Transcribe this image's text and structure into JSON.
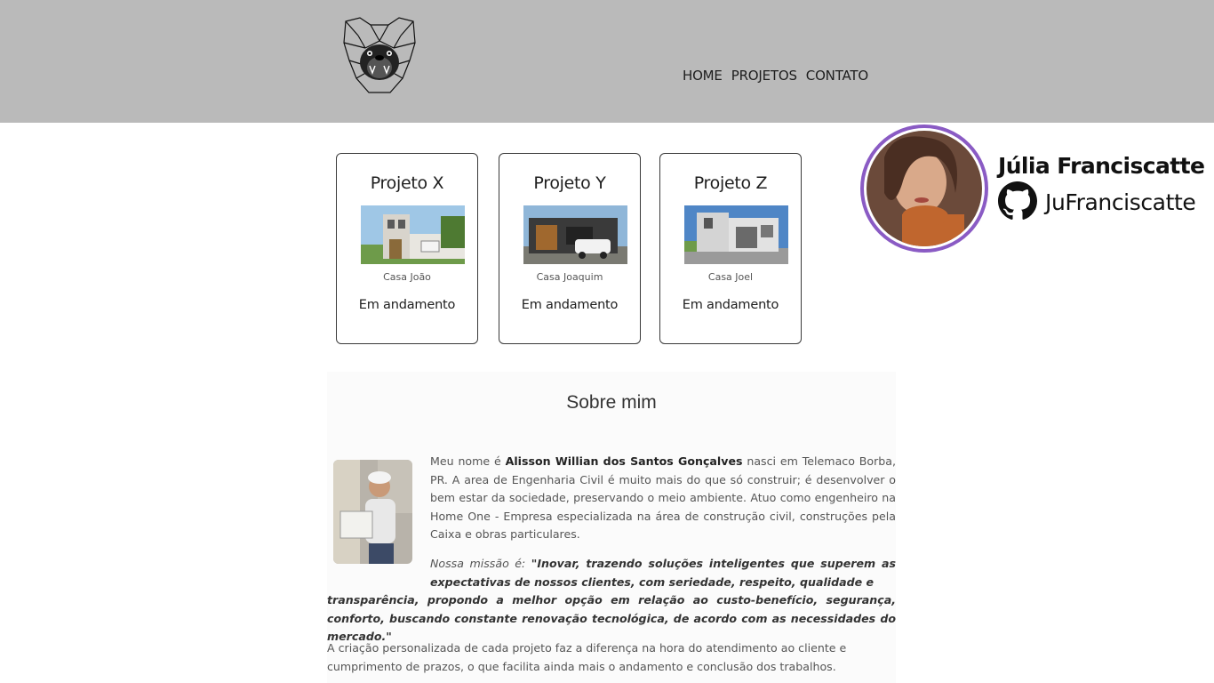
{
  "nav": {
    "items": [
      "HOME",
      "PROJETOS",
      "CONTATO"
    ]
  },
  "projects": [
    {
      "title": "Projeto X",
      "caption": "Casa João",
      "status": "Em andamento"
    },
    {
      "title": "Projeto Y",
      "caption": "Casa Joaquim",
      "status": "Em andamento"
    },
    {
      "title": "Projeto Z",
      "caption": "Casa Joel",
      "status": "Em andamento"
    }
  ],
  "profile": {
    "name": "Júlia Franciscatte",
    "github_user": "JuFranciscatte",
    "accent": "#8a5bc4"
  },
  "about": {
    "title": "Sobre mim",
    "p1_intro": "Meu nome é",
    "p1_name": "Alisson Willian dos Santos Gonçalves",
    "p1_rest": "nasci em Telemaco Borba, PR. A area de Engenharia Civil é muito mais do que só construir; é desenvolver o bem estar da sociedade, preservando o meio ambiente. Atuo como engenheiro na Home One - Empresa especializada na área de construção civil, construções pela Caixa e obras particulares.",
    "mission_label": "Nossa missão é:",
    "mission_a": "\"Inovar, trazendo soluções inteligentes que superem as expectativas de nossos clientes, com seriedade, respeito, qualidade e",
    "mission_b": "transparência, propondo a melhor opção em relação ao custo-benefício, segurança, conforto, buscando constante renovação tecnológica, de acordo com as necessidades do mercado.\"",
    "p3": "A criação personalizada de cada projeto faz a diferença na hora do atendimento ao cliente e cumprimento de prazos, o que facilita ainda mais o andamento e conclusão dos trabalhos."
  },
  "colors": {
    "header_bg": "#bababa",
    "card_border": "#3a3a3a"
  }
}
